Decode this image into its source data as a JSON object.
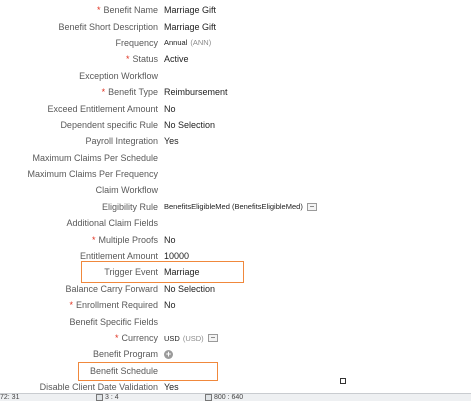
{
  "fields": [
    {
      "label": "Benefit Name",
      "required": true,
      "value": "Marriage Gift"
    },
    {
      "label": "Benefit Short Description",
      "required": false,
      "value": "Marriage Gift"
    },
    {
      "label": "Frequency",
      "required": false,
      "value": "Annual",
      "code": "(ANN)"
    },
    {
      "label": "Status",
      "required": true,
      "value": "Active"
    },
    {
      "label": "Exception Workflow",
      "required": false,
      "value": ""
    },
    {
      "label": "Benefit Type",
      "required": true,
      "value": "Reimbursement"
    },
    {
      "label": "Exceed Entitlement Amount",
      "required": false,
      "value": "No"
    },
    {
      "label": "Dependent specific Rule",
      "required": false,
      "value": "No Selection"
    },
    {
      "label": "Payroll Integration",
      "required": false,
      "value": "Yes"
    },
    {
      "label": "Maximum Claims Per Schedule",
      "required": false,
      "value": ""
    },
    {
      "label": "Maximum Claims Per Frequency",
      "required": false,
      "value": ""
    },
    {
      "label": "Claim Workflow",
      "required": false,
      "value": ""
    },
    {
      "label": "Eligibility Rule",
      "required": false,
      "value": "BenefitsEligibleMed (BenefitsEligibleMed)"
    },
    {
      "label": "Additional Claim Fields",
      "required": false,
      "value": ""
    },
    {
      "label": "Multiple Proofs",
      "required": true,
      "value": "No"
    },
    {
      "label": "Entitlement Amount",
      "required": false,
      "value": "10000"
    },
    {
      "label": "Trigger Event",
      "required": false,
      "value": "Marriage"
    },
    {
      "label": "Balance Carry Forward",
      "required": false,
      "value": "No Selection"
    },
    {
      "label": "Enrollment Required",
      "required": true,
      "value": "No"
    },
    {
      "label": "Benefit Specific Fields",
      "required": false,
      "value": ""
    },
    {
      "label": "Currency",
      "required": true,
      "value": "USD",
      "code": "(USD)"
    },
    {
      "label": "Benefit Program",
      "required": false,
      "value": ""
    },
    {
      "label": "Benefit Schedule",
      "required": false,
      "value": ""
    },
    {
      "label": "Disable Client Date Validation",
      "required": false,
      "value": "Yes"
    }
  ],
  "required_marker": "*",
  "colors": {
    "highlight": "#f0883c",
    "required": "#e0301e",
    "label": "#595959"
  },
  "icons": {
    "eligibility": "detail-icon",
    "currency": "detail-icon",
    "benefit_program": "add-icon"
  },
  "statusbar": {
    "item1": "72: 31",
    "item2": "3 : 4",
    "item3": "800 : 640"
  }
}
